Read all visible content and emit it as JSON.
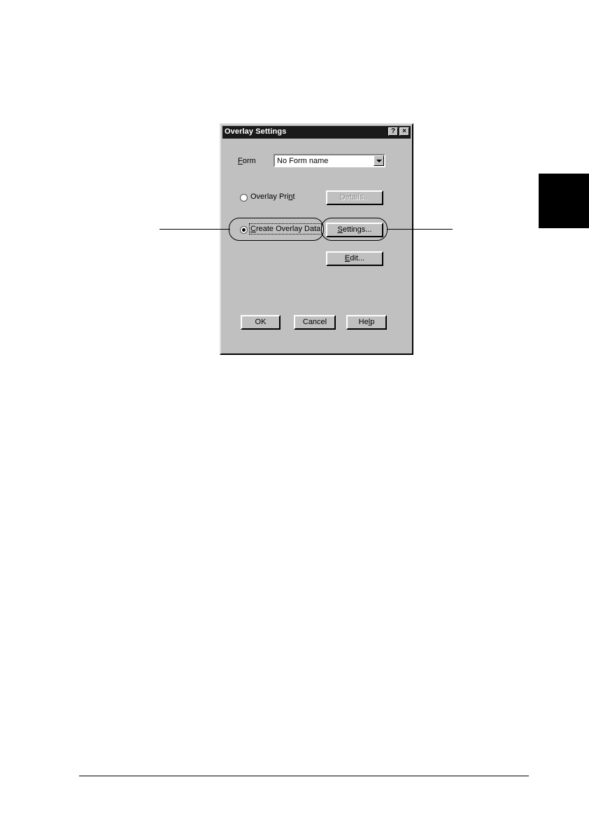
{
  "dialog": {
    "title": "Overlay Settings",
    "help_btn": "?",
    "close_btn": "×",
    "form": {
      "label_key": "F",
      "label_rest": "orm",
      "value": "No Form name"
    },
    "overlay_print": {
      "label_a": "Overlay Pri",
      "label_key": "n",
      "label_b": "t",
      "selected": false
    },
    "create_overlay": {
      "label_key": "C",
      "label_rest": "reate Overlay Data",
      "selected": true
    },
    "buttons": {
      "details": "Details...",
      "settings_key": "S",
      "settings_rest": "ettings...",
      "edit_key": "E",
      "edit_rest": "dit...",
      "ok": "OK",
      "cancel": "Cancel",
      "help_a": "He",
      "help_key": "l",
      "help_b": "p"
    }
  }
}
